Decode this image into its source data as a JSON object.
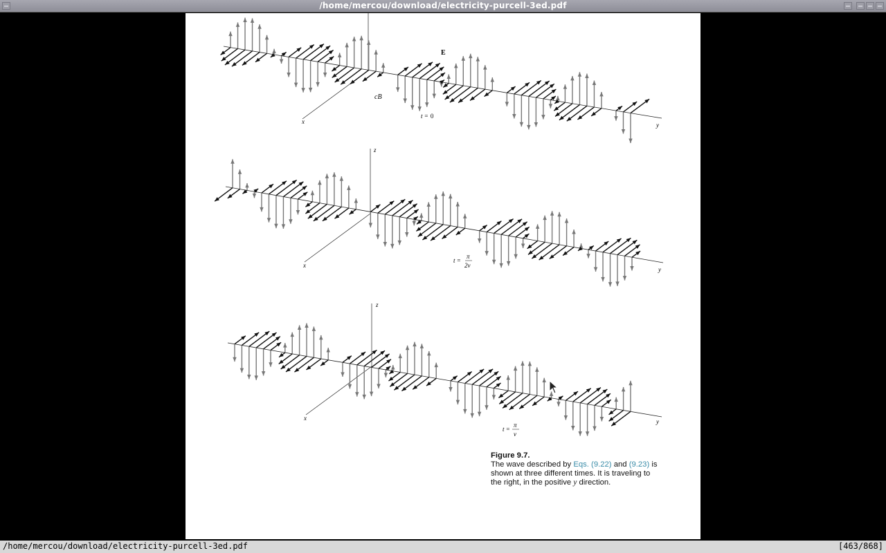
{
  "window": {
    "title": "/home/mercou/download/electricity-purcell-3ed.pdf"
  },
  "figure": {
    "labels": {
      "E": "E",
      "cB": "cB",
      "x": "x",
      "y": "y",
      "z": "z",
      "t_equals": "t =",
      "zero": "0",
      "pi": "π",
      "two_nu": "2ν",
      "nu": "ν"
    },
    "panels": [
      {
        "time": "t = 0"
      },
      {
        "time": "t = π / 2ν"
      },
      {
        "time": "t = π / ν"
      }
    ]
  },
  "caption": {
    "title": "Figure 9.7.",
    "line1_pre": "The wave described by ",
    "eq1": "Eqs. (9.22)",
    "and": " and ",
    "eq2": "(9.23)",
    "line1_post": " is",
    "line2": "shown at three different times. It is traveling to",
    "line3_pre": "the right, in the positive ",
    "line3_var": "y",
    "line3_post": " direction."
  },
  "statusbar": {
    "path": "/home/mercou/download/electricity-purcell-3ed.pdf",
    "page_indicator": "[463/868]"
  }
}
